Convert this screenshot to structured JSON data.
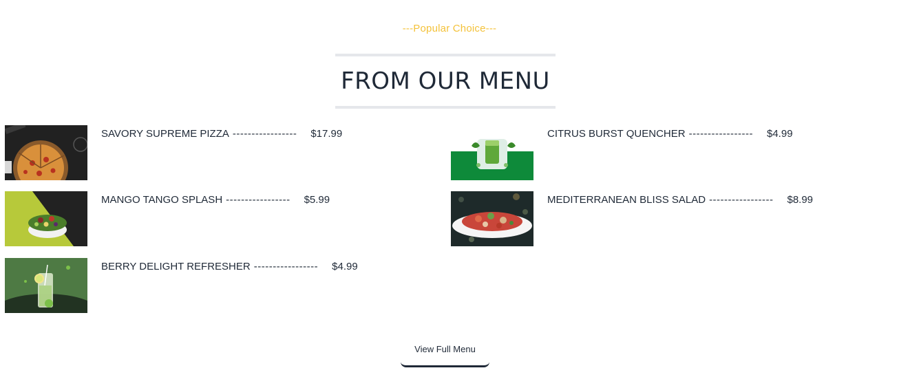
{
  "section": {
    "tagline": "---Popular Choice---",
    "title": "FROM OUR MENU"
  },
  "menu": {
    "items": [
      {
        "name": "SAVORY SUPREME PIZZA",
        "dashes": "-----------------",
        "price": "$17.99",
        "image_icon": "pizza-image"
      },
      {
        "name": "CITRUS BURST QUENCHER",
        "dashes": "-----------------",
        "price": "$4.99",
        "image_icon": "green-drink-image"
      },
      {
        "name": "MANGO TANGO SPLASH",
        "dashes": "-----------------",
        "price": "$5.99",
        "image_icon": "salad-bowl-image"
      },
      {
        "name": "MEDITERRANEAN BLISS SALAD",
        "dashes": "-----------------",
        "price": "$8.99",
        "image_icon": "salad-plate-image"
      },
      {
        "name": "BERRY DELIGHT REFRESHER",
        "dashes": "-----------------",
        "price": "$4.99",
        "image_icon": "mojito-image"
      }
    ]
  },
  "cta": {
    "label": "View Full Menu"
  },
  "colors": {
    "accent": "#f4c23a",
    "text": "#1f2937",
    "divider": "#e5e7eb"
  }
}
